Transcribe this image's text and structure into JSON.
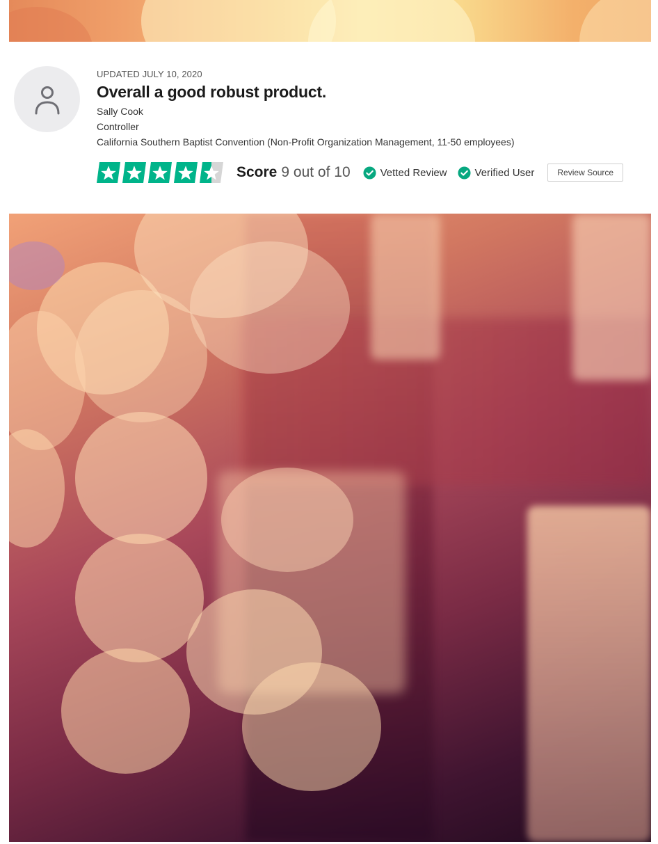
{
  "review": {
    "updated": "UPDATED JULY 10, 2020",
    "title": "Overall a good robust product.",
    "reviewer_name": "Sally Cook",
    "reviewer_role": "Controller",
    "reviewer_company": "California Southern Baptist Convention (Non-Profit Organization Management, 11-50 employees)",
    "score_label": "Score",
    "score_text": "9 out of 10",
    "rating": 4.5,
    "rating_max": 5,
    "badges": [
      "Vetted Review",
      "Verified User"
    ],
    "review_source_label": "Review Source"
  },
  "colors": {
    "star_green": "#00b48a",
    "check_teal": "#07a880",
    "avatar_bg": "#ececee"
  },
  "icons": [
    "user-icon",
    "star-icon",
    "check-circle-icon"
  ]
}
